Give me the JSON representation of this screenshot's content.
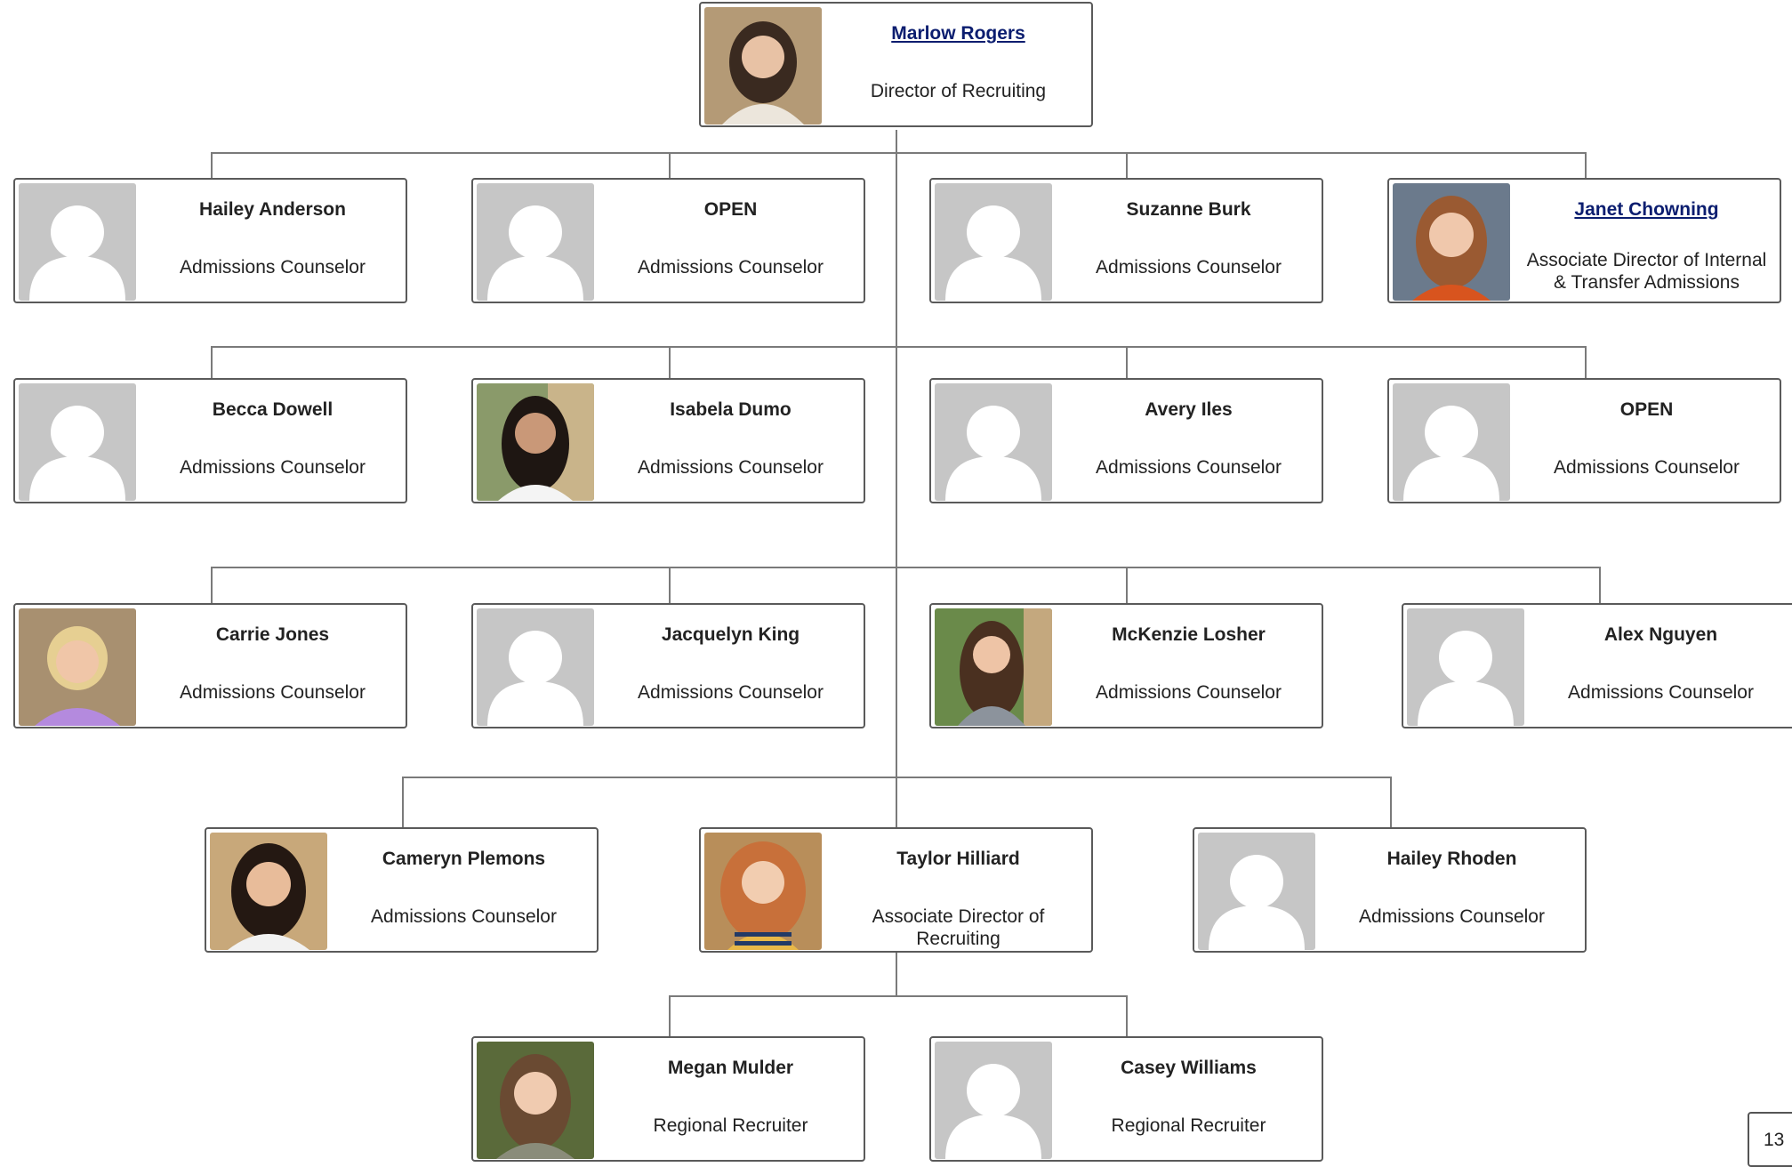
{
  "org_chart": {
    "director": {
      "name": "Marlow Rogers",
      "title": "Director of Recruiting",
      "photo": "photo-woman-brown-hair"
    },
    "row1": [
      {
        "name": "Hailey Anderson",
        "title": "Admissions Counselor",
        "photo": "placeholder-avatar"
      },
      {
        "name": "OPEN",
        "title": "Admissions Counselor",
        "photo": "placeholder-avatar"
      },
      {
        "name": "Suzanne Burk",
        "title": "Admissions Counselor",
        "photo": "placeholder-avatar"
      },
      {
        "name": "Janet Chowning",
        "title": "Associate Director of Internal & Transfer Admissions",
        "photo": "photo-woman-auburn-hair"
      }
    ],
    "row2": [
      {
        "name": "Becca Dowell",
        "title": "Admissions Counselor",
        "photo": "placeholder-avatar"
      },
      {
        "name": "Isabela Dumo",
        "title": "Admissions Counselor",
        "photo": "photo-woman-dark-hair"
      },
      {
        "name": "Avery Iles",
        "title": "Admissions Counselor",
        "photo": "placeholder-avatar"
      },
      {
        "name": "OPEN",
        "title": "Admissions Counselor",
        "photo": "placeholder-avatar"
      }
    ],
    "row3": [
      {
        "name": "Carrie Jones",
        "title": "Admissions Counselor",
        "photo": "photo-woman-blonde-hair"
      },
      {
        "name": "Jacquelyn King",
        "title": "Admissions Counselor",
        "photo": "placeholder-avatar"
      },
      {
        "name": "McKenzie Losher",
        "title": "Admissions Counselor",
        "photo": "photo-woman-long-brown-hair"
      },
      {
        "name": "Alex Nguyen",
        "title": "Admissions Counselor",
        "photo": "placeholder-avatar"
      }
    ],
    "row4": [
      {
        "name": "Cameryn Plemons",
        "title": "Admissions Counselor",
        "photo": "photo-woman-dark-hair"
      },
      {
        "name": "Taylor Hilliard",
        "title": "Associate Director of Recruiting",
        "photo": "photo-woman-red-hair"
      },
      {
        "name": "Hailey Rhoden",
        "title": "Admissions Counselor",
        "photo": "placeholder-avatar"
      }
    ],
    "row5": [
      {
        "name": "Megan Mulder",
        "title": "Regional Recruiter",
        "photo": "photo-woman-brown-hair"
      },
      {
        "name": "Casey Williams",
        "title": "Regional Recruiter",
        "photo": "placeholder-avatar"
      }
    ]
  },
  "page_number": "13",
  "colors": {
    "connector": "#7a7a7a",
    "card_border": "#5a5a5a",
    "link": "#0b1d6f",
    "placeholder_bg": "#c6c6c6"
  }
}
